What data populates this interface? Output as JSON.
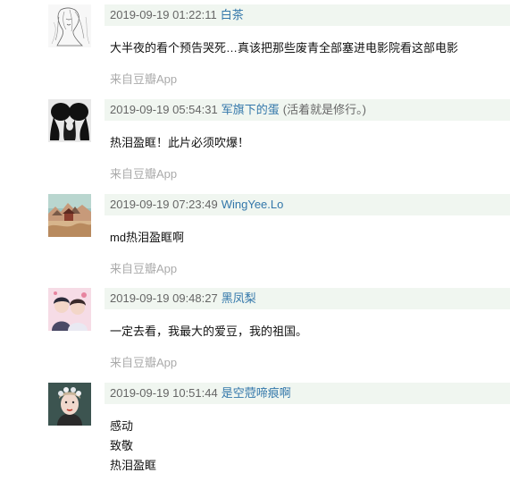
{
  "comments": [
    {
      "time": "2019-09-19 01:22:11",
      "user": "白茶",
      "signature": "",
      "lines": [
        "大半夜的看个预告哭死…真该把那些废青全部塞进电影院看这部电影"
      ],
      "source": "来自豆瓣App",
      "avatar_icon": "sketch-portrait-avatar"
    },
    {
      "time": "2019-09-19 05:54:31",
      "user": "军旗下的蛋",
      "signature": "(活着就是修行。)",
      "lines": [
        "热泪盈眶！此片必须吹爆！"
      ],
      "source": "来自豆瓣App",
      "avatar_icon": "black-white-figure-avatar"
    },
    {
      "time": "2019-09-19 07:23:49",
      "user": "WingYee.Lo",
      "signature": "",
      "lines": [
        "md热泪盈眶啊"
      ],
      "source": "来自豆瓣App",
      "avatar_icon": "landscape-illustration-avatar"
    },
    {
      "time": "2019-09-19 09:48:27",
      "user": "黑凤梨",
      "signature": "",
      "lines": [
        "一定去看，我最大的爱豆，我的祖国。"
      ],
      "source": "来自豆瓣App",
      "avatar_icon": "pink-couple-avatar"
    },
    {
      "time": "2019-09-19 10:51:44",
      "user": "是空蒄啼痕啊",
      "signature": "",
      "lines": [
        "感动",
        "致敬",
        "热泪盈眶"
      ],
      "source": "",
      "avatar_icon": "flower-crown-portrait-avatar"
    }
  ]
}
